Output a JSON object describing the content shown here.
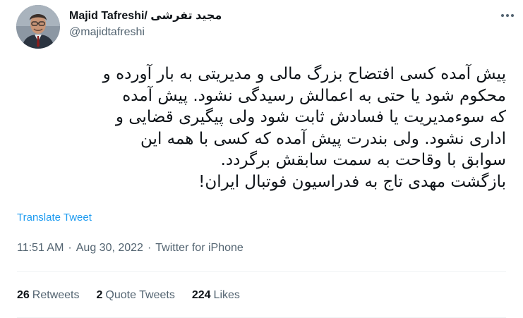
{
  "author": {
    "display_name": "Majid Tafreshi/ مجید تفرشی",
    "handle": "@majidtafreshi"
  },
  "tweet": {
    "lines": [
      "پیش آمده کسی افتضاح بزرگ مالی و مدیریتی به بار آورده و",
      "محکوم شود یا حتی به اعمالش رسیدگی نشود. پیش آمده",
      "که سوءمدیریت یا فسادش ثابت شود ولی پیگیری قضایی و",
      "اداری نشود. ولی بندرت پیش آمده که کسی با همه این",
      "سوابق با وقاحت به سمت سابقش برگردد.",
      "بازگشت مهدی تاج به فدراسیون فوتبال ایران!"
    ],
    "translate_label": "Translate Tweet"
  },
  "meta": {
    "time": "11:51 AM",
    "date": "Aug 30, 2022",
    "source": "Twitter for iPhone",
    "separator": "·"
  },
  "stats": {
    "retweets_count": "26",
    "retweets_label": "Retweets",
    "quotes_count": "2",
    "quotes_label": "Quote Tweets",
    "likes_count": "224",
    "likes_label": "Likes"
  },
  "icons": {
    "more": "more-options-icon",
    "avatar": "profile-photo"
  },
  "colors": {
    "link": "#1d9bf0",
    "secondary_text": "#536471",
    "primary_text": "#0f1419",
    "divider": "#eff3f4"
  }
}
